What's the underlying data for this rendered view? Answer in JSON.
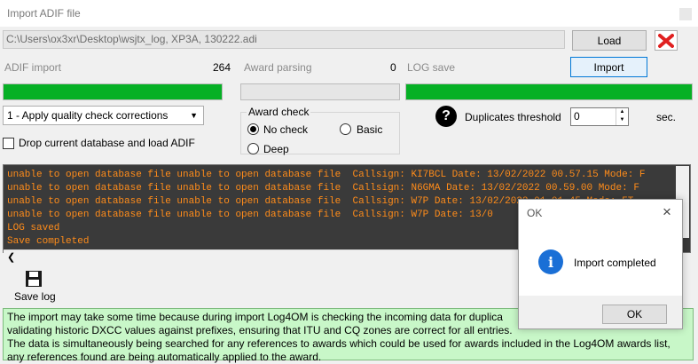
{
  "window": {
    "title": "Import ADIF file"
  },
  "file": {
    "path": "C:\\Users\\ox3xr\\Desktop\\wsjtx_log, XP3A, 130222.adi",
    "load_label": "Load"
  },
  "status": {
    "adif_import_label": "ADIF import",
    "adif_import_count": "264",
    "award_parsing_label": "Award parsing",
    "award_parsing_count": "0",
    "log_save_label": "LOG save",
    "import_label": "Import"
  },
  "progress": {
    "adif_import": 1.0,
    "award_parsing": 0.0,
    "log_save": 1.0
  },
  "options": {
    "mode_selected": "1 - Apply quality check corrections",
    "drop_db_label": "Drop current database and load ADIF",
    "award_check_title": "Award check",
    "no_check_label": "No check",
    "basic_label": "Basic",
    "deep_label": "Deep",
    "dup_label": "Duplicates threshold",
    "dup_value": "0",
    "dup_unit": "sec."
  },
  "log_lines": [
    "unable to open database file unable to open database file  Callsign: KI7BCL Date: 13/02/2022 00.57.15 Mode: F",
    "unable to open database file unable to open database file  Callsign: N6GMA Date: 13/02/2022 00.59.00 Mode: F",
    "unable to open database file unable to open database file  Callsign: W7P Date: 13/02/2022 01.01.45 Mode: FT",
    "unable to open database file unable to open database file  Callsign: W7P Date: 13/0",
    "LOG saved",
    "Save completed"
  ],
  "toolbar": {
    "save_log_label": "Save log"
  },
  "info": {
    "line1": "The import may take some time because during  import Log4OM is checking the incoming data for duplica",
    "line2": "validating historic DXCC values against prefixes, ensuring that ITU and CQ zones are correct for all entries.",
    "line3": "The data is simultaneously being searched for any references to awards which could be used for awards included in the Log4OM awards list,",
    "line4": "any references found are being automatically applied to the award."
  },
  "dialog": {
    "title": "OK",
    "message": "Import completed",
    "ok_label": "OK"
  },
  "colors": {
    "progress_fill": "#06b025",
    "log_text": "#ff8c1a",
    "log_bg": "#3a3a3a",
    "info_bg": "#c8f7c8"
  }
}
